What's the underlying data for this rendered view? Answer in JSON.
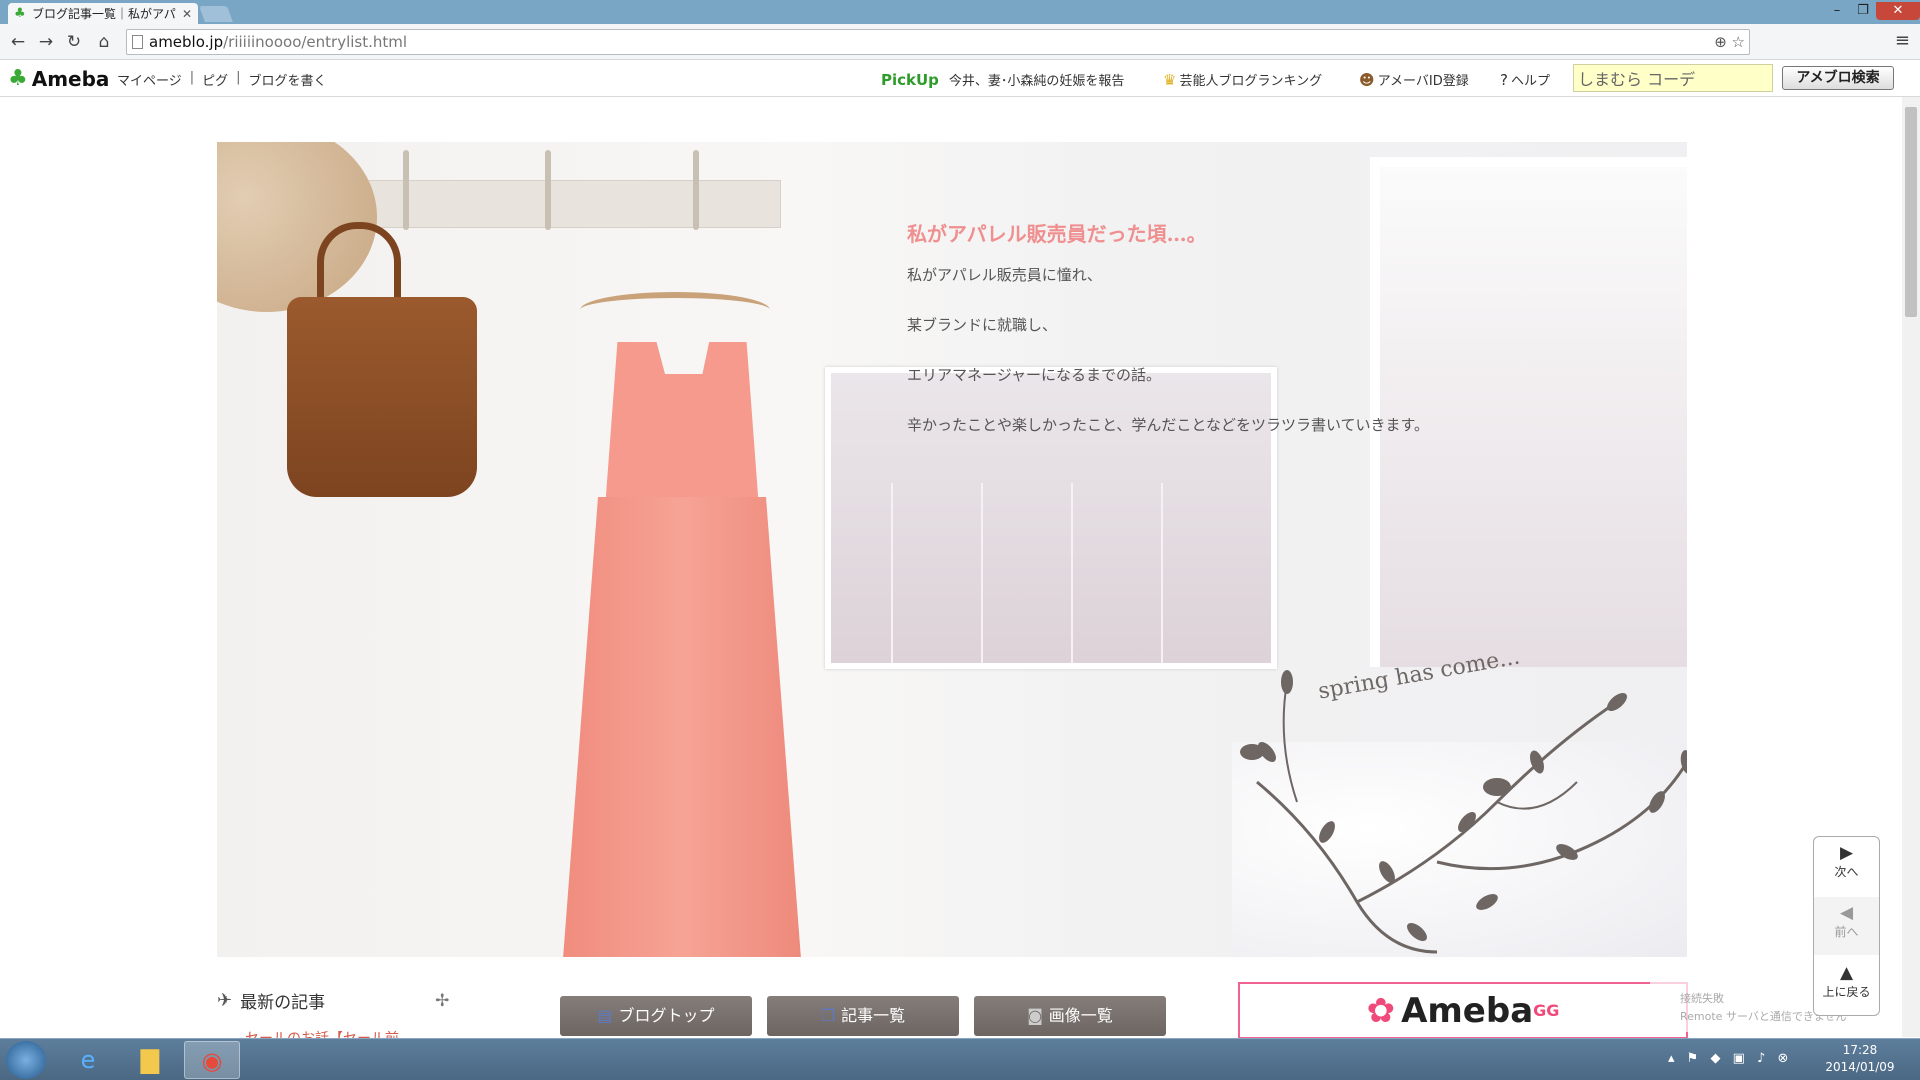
{
  "browser": {
    "tab_title": "ブログ記事一覧｜私がアパレ",
    "url_host": "ameblo.jp",
    "url_path": "/riiiiinoooo/entrylist.html"
  },
  "header": {
    "logo": "Ameba",
    "nav": [
      "マイページ",
      "ピグ",
      "ブログを書く"
    ],
    "pickup_label": "PickUp",
    "pickup_text": "今井、妻･小森純の妊娠を報告",
    "links": {
      "ranking": "芸能人ブログランキング",
      "register": "アメーバID登録",
      "help": "ヘルプ"
    },
    "search_value": "しまむら コーデ",
    "search_button": "アメブロ検索"
  },
  "hero": {
    "title": "私がアパレル販売員だった頃…。",
    "lines": [
      "私がアパレル販売員に憧れ、",
      "某ブランドに就職し、",
      "エリアマネージャーになるまでの話。",
      "辛かったことや楽しかったこと、学んだことなどをツラツラ書いていきます。"
    ],
    "spring": "spring has come..."
  },
  "sidebar": {
    "latest_title": "最新の記事",
    "latest_item": "セールのお話【セール前"
  },
  "footer_nav": {
    "blog_top": "ブログトップ",
    "entry_list": "記事一覧",
    "image_list": "画像一覧"
  },
  "banner": {
    "brand": "Ameba",
    "suffix": "GG"
  },
  "toast": {
    "title": "接続失敗",
    "body": "Remote サーバと通信できません"
  },
  "side_nav": {
    "next": "次へ",
    "prev": "前へ",
    "top": "上に戻る"
  },
  "taskbar": {
    "time": "17:28",
    "date": "2014/01/09"
  },
  "colors": {
    "hero_title": "#ef8f8f",
    "pickup": "#2e9c2a",
    "accent_pink": "#f04a7a"
  }
}
